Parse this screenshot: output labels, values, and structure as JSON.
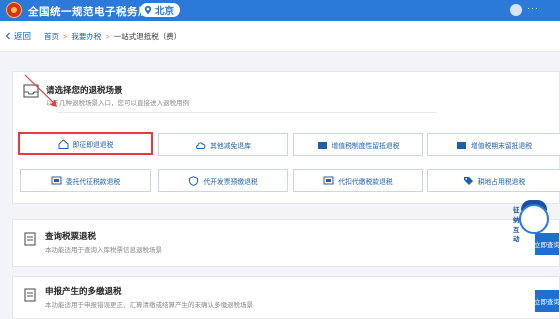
{
  "header": {
    "app_title": "全国统一规范电子税务局",
    "region": "北京",
    "user_dots": "···"
  },
  "breadcrumb": {
    "back": "返回",
    "items": [
      "首页",
      "我要办税"
    ],
    "current": "一站式退抵税（费）",
    "separator": ">"
  },
  "scenario_card": {
    "title": "请选择您的退税场景",
    "description": "以下几种退税场景入口，您可以直接进入退税用例",
    "options": [
      {
        "label": "即征即退退税",
        "icon": "house-icon",
        "selected": true
      },
      {
        "label": "其他减免退库",
        "icon": "cloud-icon",
        "selected": false
      },
      {
        "label": "增值税制度性留抵退税",
        "icon": "card-icon",
        "selected": false
      },
      {
        "label": "增值税期末留抵退税",
        "icon": "card-icon",
        "selected": false
      },
      {
        "label": "委托代征税款退税",
        "icon": "screen-icon",
        "selected": false
      },
      {
        "label": "代开发票预缴退税",
        "icon": "shield-icon",
        "selected": false
      },
      {
        "label": "代扣代缴税款退税",
        "icon": "screen-icon",
        "selected": false
      },
      {
        "label": "耕地占用税退税",
        "icon": "tag-icon",
        "selected": false
      }
    ]
  },
  "query_card": {
    "title": "查询税票退税",
    "description": "本功能适用于查询入库税票信息退税场景",
    "button": "立即查询"
  },
  "multi_card": {
    "title": "申报产生的多缴退税",
    "description": "本功能适用于申报错误更正、汇算清缴或结算产生的未确认多缴退税场景",
    "button": "立即查询"
  },
  "mascot": {
    "lines": [
      "征",
      "纳",
      "互",
      "动"
    ]
  },
  "colors": {
    "primary": "#2b7ad9",
    "selected_border": "#e23b3b",
    "link": "#1e63b8"
  }
}
